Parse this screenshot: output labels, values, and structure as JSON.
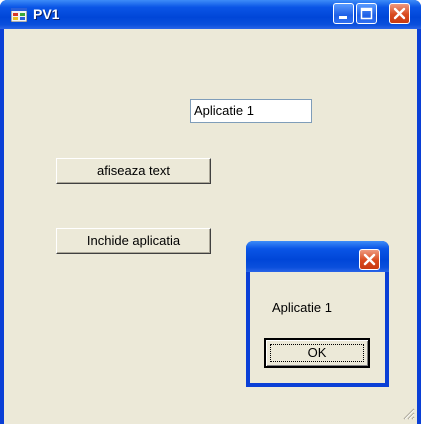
{
  "window": {
    "title": "PV1",
    "icon": "app-window-icon",
    "controls": [
      "minimize-icon",
      "maximize-icon",
      "close-icon"
    ]
  },
  "form": {
    "textbox_value": "Aplicatie 1",
    "button_show_text": "afiseaza text",
    "button_close_app": "Inchide aplicatia"
  },
  "message_box": {
    "message": "Aplicatie 1",
    "ok_label": "OK"
  },
  "colors": {
    "title_blue": "#0a55e6",
    "client_bg": "#ece9d8",
    "close_red": "#d94a1e"
  }
}
